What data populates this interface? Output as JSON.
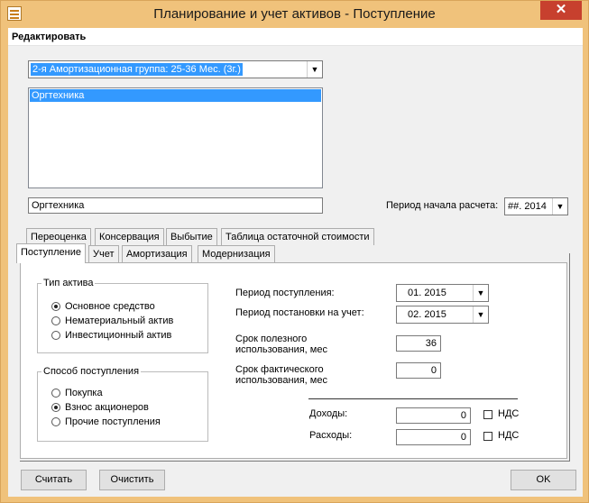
{
  "window": {
    "title": "Планирование и учет активов - Поступление",
    "close_label": "✕"
  },
  "menu": {
    "edit_label": "Редактировать"
  },
  "group_combo": {
    "value": "2-я   Амортизационная группа: 25-36    Мес.   (3г.)"
  },
  "asset_list": {
    "items": [
      "Оргтехника"
    ]
  },
  "asset_name": {
    "value": "Оргтехника"
  },
  "calc_period": {
    "label": "Период начала расчета:",
    "value": "##. 2014"
  },
  "tabs_row1": [
    "Переоценка",
    "Консервация",
    "Выбытие",
    "Таблица остаточной стоимости"
  ],
  "tabs_row2": [
    "Поступление",
    "Учет",
    "Амортизация",
    "Модернизация"
  ],
  "asset_type": {
    "legend": "Тип актива",
    "options": [
      "Основное средство",
      "Нематериальный актив",
      "Инвестиционный актив"
    ],
    "selected": 0
  },
  "receipt_method": {
    "legend": "Способ поступления",
    "options": [
      "Покупка",
      "Взнос акционеров",
      "Прочие поступления"
    ],
    "selected": 1
  },
  "receipt_period": {
    "label": "Период поступления:",
    "value": "01. 2015"
  },
  "registration_period": {
    "label": "Период постановки на учет:",
    "value": "02. 2015"
  },
  "useful_life": {
    "label_line1": "Срок полезного",
    "label_line2": "использования, мес",
    "value": "36"
  },
  "actual_life": {
    "label_line1": "Срок фактического",
    "label_line2": "использования, мес",
    "value": "0"
  },
  "income": {
    "label": "Доходы:",
    "value": "0",
    "vat_label": "НДС"
  },
  "expenses": {
    "label": "Расходы:",
    "value": "0",
    "vat_label": "НДС"
  },
  "buttons": {
    "calculate": "Считать",
    "clear": "Очистить",
    "ok": "OK"
  }
}
